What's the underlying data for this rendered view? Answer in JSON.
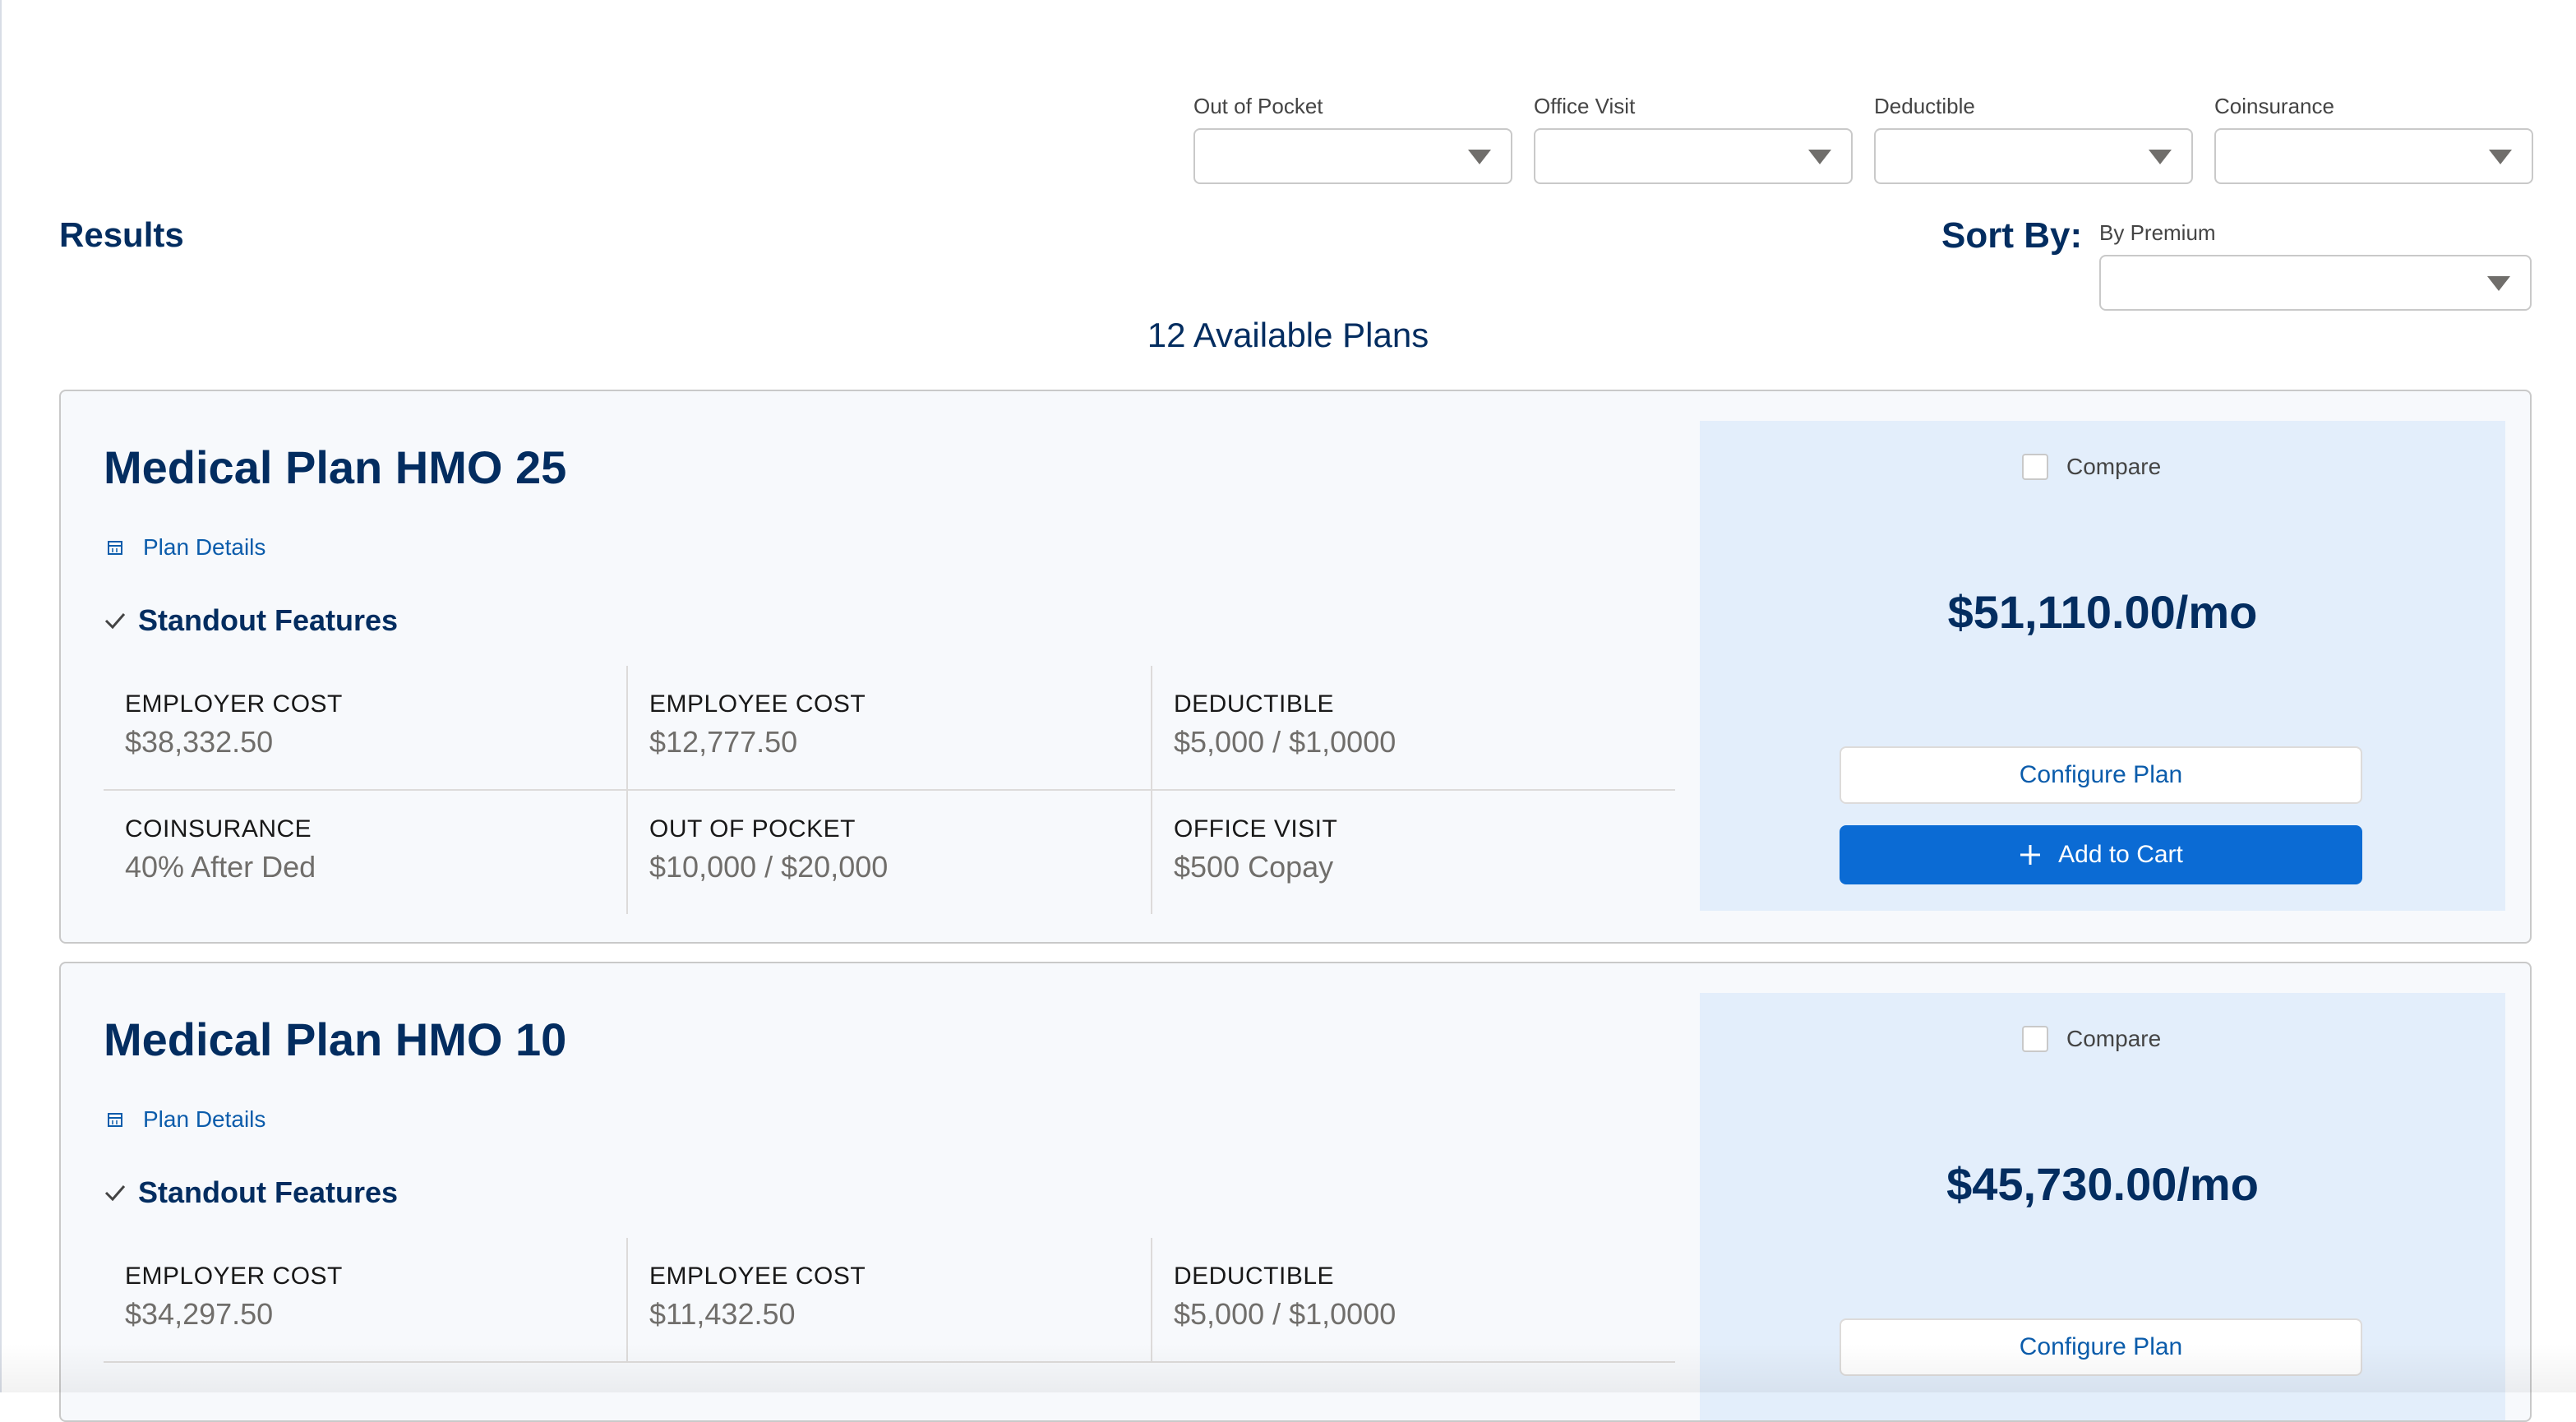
{
  "filters": [
    {
      "label": "Out of Pocket",
      "value": ""
    },
    {
      "label": "Office Visit",
      "value": ""
    },
    {
      "label": "Deductible",
      "value": ""
    },
    {
      "label": "Coinsurance",
      "value": ""
    }
  ],
  "results_title": "Results",
  "sort": {
    "label": "Sort By:",
    "sub_label": "By Premium",
    "value": ""
  },
  "available_count": "12 Available Plans",
  "plans": [
    {
      "name": "Medical Plan HMO 25",
      "details_link": "Plan Details",
      "standout_label": "Standout Features",
      "metrics": [
        {
          "label": "EMPLOYER COST",
          "value": "$38,332.50"
        },
        {
          "label": "EMPLOYEE COST",
          "value": "$12,777.50"
        },
        {
          "label": "DEDUCTIBLE",
          "value": "$5,000 / $1,0000"
        },
        {
          "label": "COINSURANCE",
          "value": "40% After Ded"
        },
        {
          "label": "OUT OF POCKET",
          "value": "$10,000 / $20,000"
        },
        {
          "label": "OFFICE VISIT",
          "value": "$500 Copay"
        }
      ],
      "compare_label": "Compare",
      "price": "$51,110.00/mo",
      "configure_label": "Configure Plan",
      "add_to_cart_label": "Add to Cart"
    },
    {
      "name": "Medical Plan HMO 10",
      "details_link": "Plan Details",
      "standout_label": "Standout Features",
      "metrics": [
        {
          "label": "EMPLOYER COST",
          "value": "$34,297.50"
        },
        {
          "label": "EMPLOYEE COST",
          "value": "$11,432.50"
        },
        {
          "label": "DEDUCTIBLE",
          "value": "$5,000 / $1,0000"
        }
      ],
      "compare_label": "Compare",
      "price": "$45,730.00/mo",
      "configure_label": "Configure Plan"
    }
  ],
  "colors": {
    "heading": "#032d60",
    "link": "#0b5cab",
    "primary_button": "#0b6bd4",
    "price_panel": "#e3eefb",
    "card_background": "#f7f9fc"
  }
}
